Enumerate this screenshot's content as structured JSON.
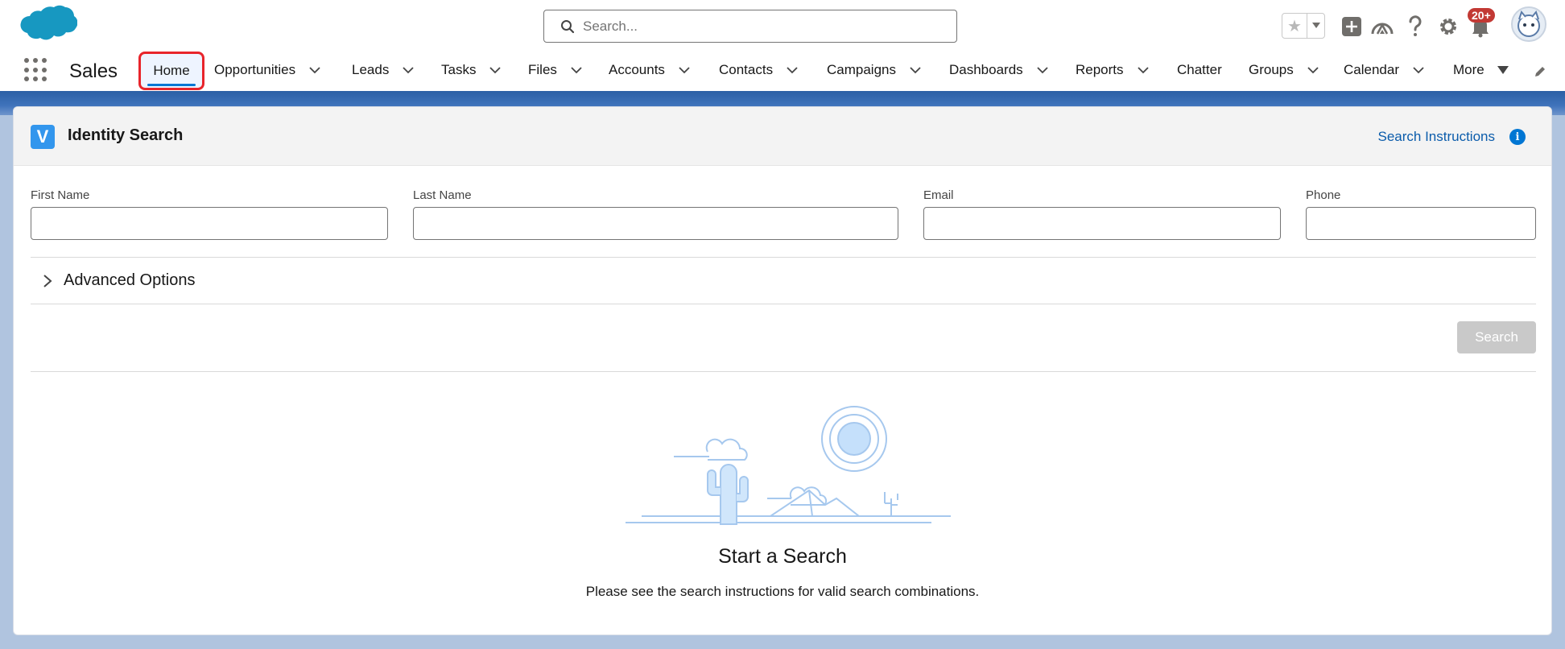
{
  "header": {
    "search": {
      "placeholder": "Search..."
    },
    "notifications_badge": "20+",
    "icons": [
      "salesforce-logo",
      "favorites-star-icon",
      "global-actions-plus-icon",
      "trailhead-icon",
      "help-icon",
      "setup-gear-icon",
      "notifications-bell-icon",
      "user-avatar"
    ]
  },
  "nav": {
    "app_name": "Sales",
    "items": [
      {
        "label": "Home",
        "active": true
      },
      {
        "label": "Opportunities"
      },
      {
        "label": "Leads"
      },
      {
        "label": "Tasks"
      },
      {
        "label": "Files"
      },
      {
        "label": "Accounts"
      },
      {
        "label": "Contacts"
      },
      {
        "label": "Campaigns"
      },
      {
        "label": "Dashboards"
      },
      {
        "label": "Reports"
      },
      {
        "label": "Chatter"
      },
      {
        "label": "Groups"
      },
      {
        "label": "Calendar"
      },
      {
        "label": "More"
      }
    ]
  },
  "card": {
    "logo_letter": "V",
    "title": "Identity Search",
    "instructions_link": "Search Instructions",
    "info_glyph": "i",
    "fields": {
      "first_name": {
        "label": "First Name",
        "value": ""
      },
      "last_name": {
        "label": "Last Name",
        "value": ""
      },
      "email": {
        "label": "Email",
        "value": ""
      },
      "phone": {
        "label": "Phone",
        "value": ""
      }
    },
    "advanced_options": "Advanced Options",
    "search_button": "Search",
    "empty_state": {
      "title": "Start a Search",
      "subtitle": "Please see the search instructions for valid search combinations."
    }
  },
  "colors": {
    "brand_blue": "#0176d3",
    "highlight_red": "#e8242b",
    "disabled_button": "#c9c9c9",
    "link": "#0b5cab"
  }
}
